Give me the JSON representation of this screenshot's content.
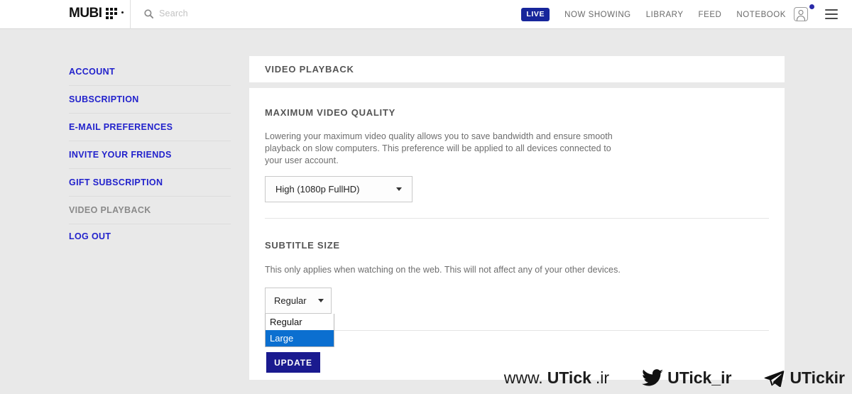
{
  "topbar": {
    "logo_text": "MUBI",
    "logo_icon": "mubi-dot-grid-logo",
    "search": {
      "icon": "search-icon",
      "placeholder": "Search",
      "value": ""
    },
    "live_badge": "LIVE",
    "nav_links": [
      {
        "label": "NOW SHOWING"
      },
      {
        "label": "LIBRARY"
      },
      {
        "label": "FEED"
      },
      {
        "label": "NOTEBOOK"
      }
    ],
    "avatar_icon": "avatar-icon",
    "notification_icon": "notification-dot",
    "menu_icon": "hamburger-menu-icon"
  },
  "sidebar": {
    "items": [
      {
        "label": "ACCOUNT",
        "active": false
      },
      {
        "label": "SUBSCRIPTION",
        "active": false
      },
      {
        "label": "E-MAIL PREFERENCES",
        "active": false
      },
      {
        "label": "INVITE YOUR FRIENDS",
        "active": false
      },
      {
        "label": "GIFT SUBSCRIPTION",
        "active": false
      },
      {
        "label": "VIDEO PLAYBACK",
        "active": true
      },
      {
        "label": "LOG OUT",
        "active": false
      }
    ]
  },
  "main": {
    "panel_title": "VIDEO PLAYBACK",
    "quality_section": {
      "title": "MAXIMUM VIDEO QUALITY",
      "description": "Lowering your maximum video quality allows you to save bandwidth and ensure smooth playback on slow computers. This preference will be applied to all devices connected to your user account.",
      "selected": "High (1080p FullHD)",
      "caret_icon": "chevron-down-icon"
    },
    "subtitle_section": {
      "title": "SUBTITLE SIZE",
      "description": "This only applies when watching on the web. This will not affect any of your other devices.",
      "selected": "Regular",
      "caret_icon": "chevron-down-icon",
      "options": [
        {
          "label": "Regular",
          "highlighted": false
        },
        {
          "label": "Large",
          "highlighted": true
        }
      ]
    },
    "update_button": "UPDATE"
  },
  "watermarks": [
    {
      "icon": "",
      "prefix": "www.",
      "name": "UTick",
      "suffix": ".ir"
    },
    {
      "icon": "twitter-bird-icon",
      "prefix": "",
      "name": "UTick_ir",
      "suffix": ""
    },
    {
      "icon": "telegram-plane-icon",
      "prefix": "",
      "name": "UTickir",
      "suffix": ""
    }
  ],
  "colors": {
    "accent_blue": "#2222cc",
    "live_badge_bg": "#17269b",
    "dropdown_highlight": "#0b6fd0",
    "update_button_bg": "#1a1a8f",
    "page_bg": "#e9e9e9"
  }
}
